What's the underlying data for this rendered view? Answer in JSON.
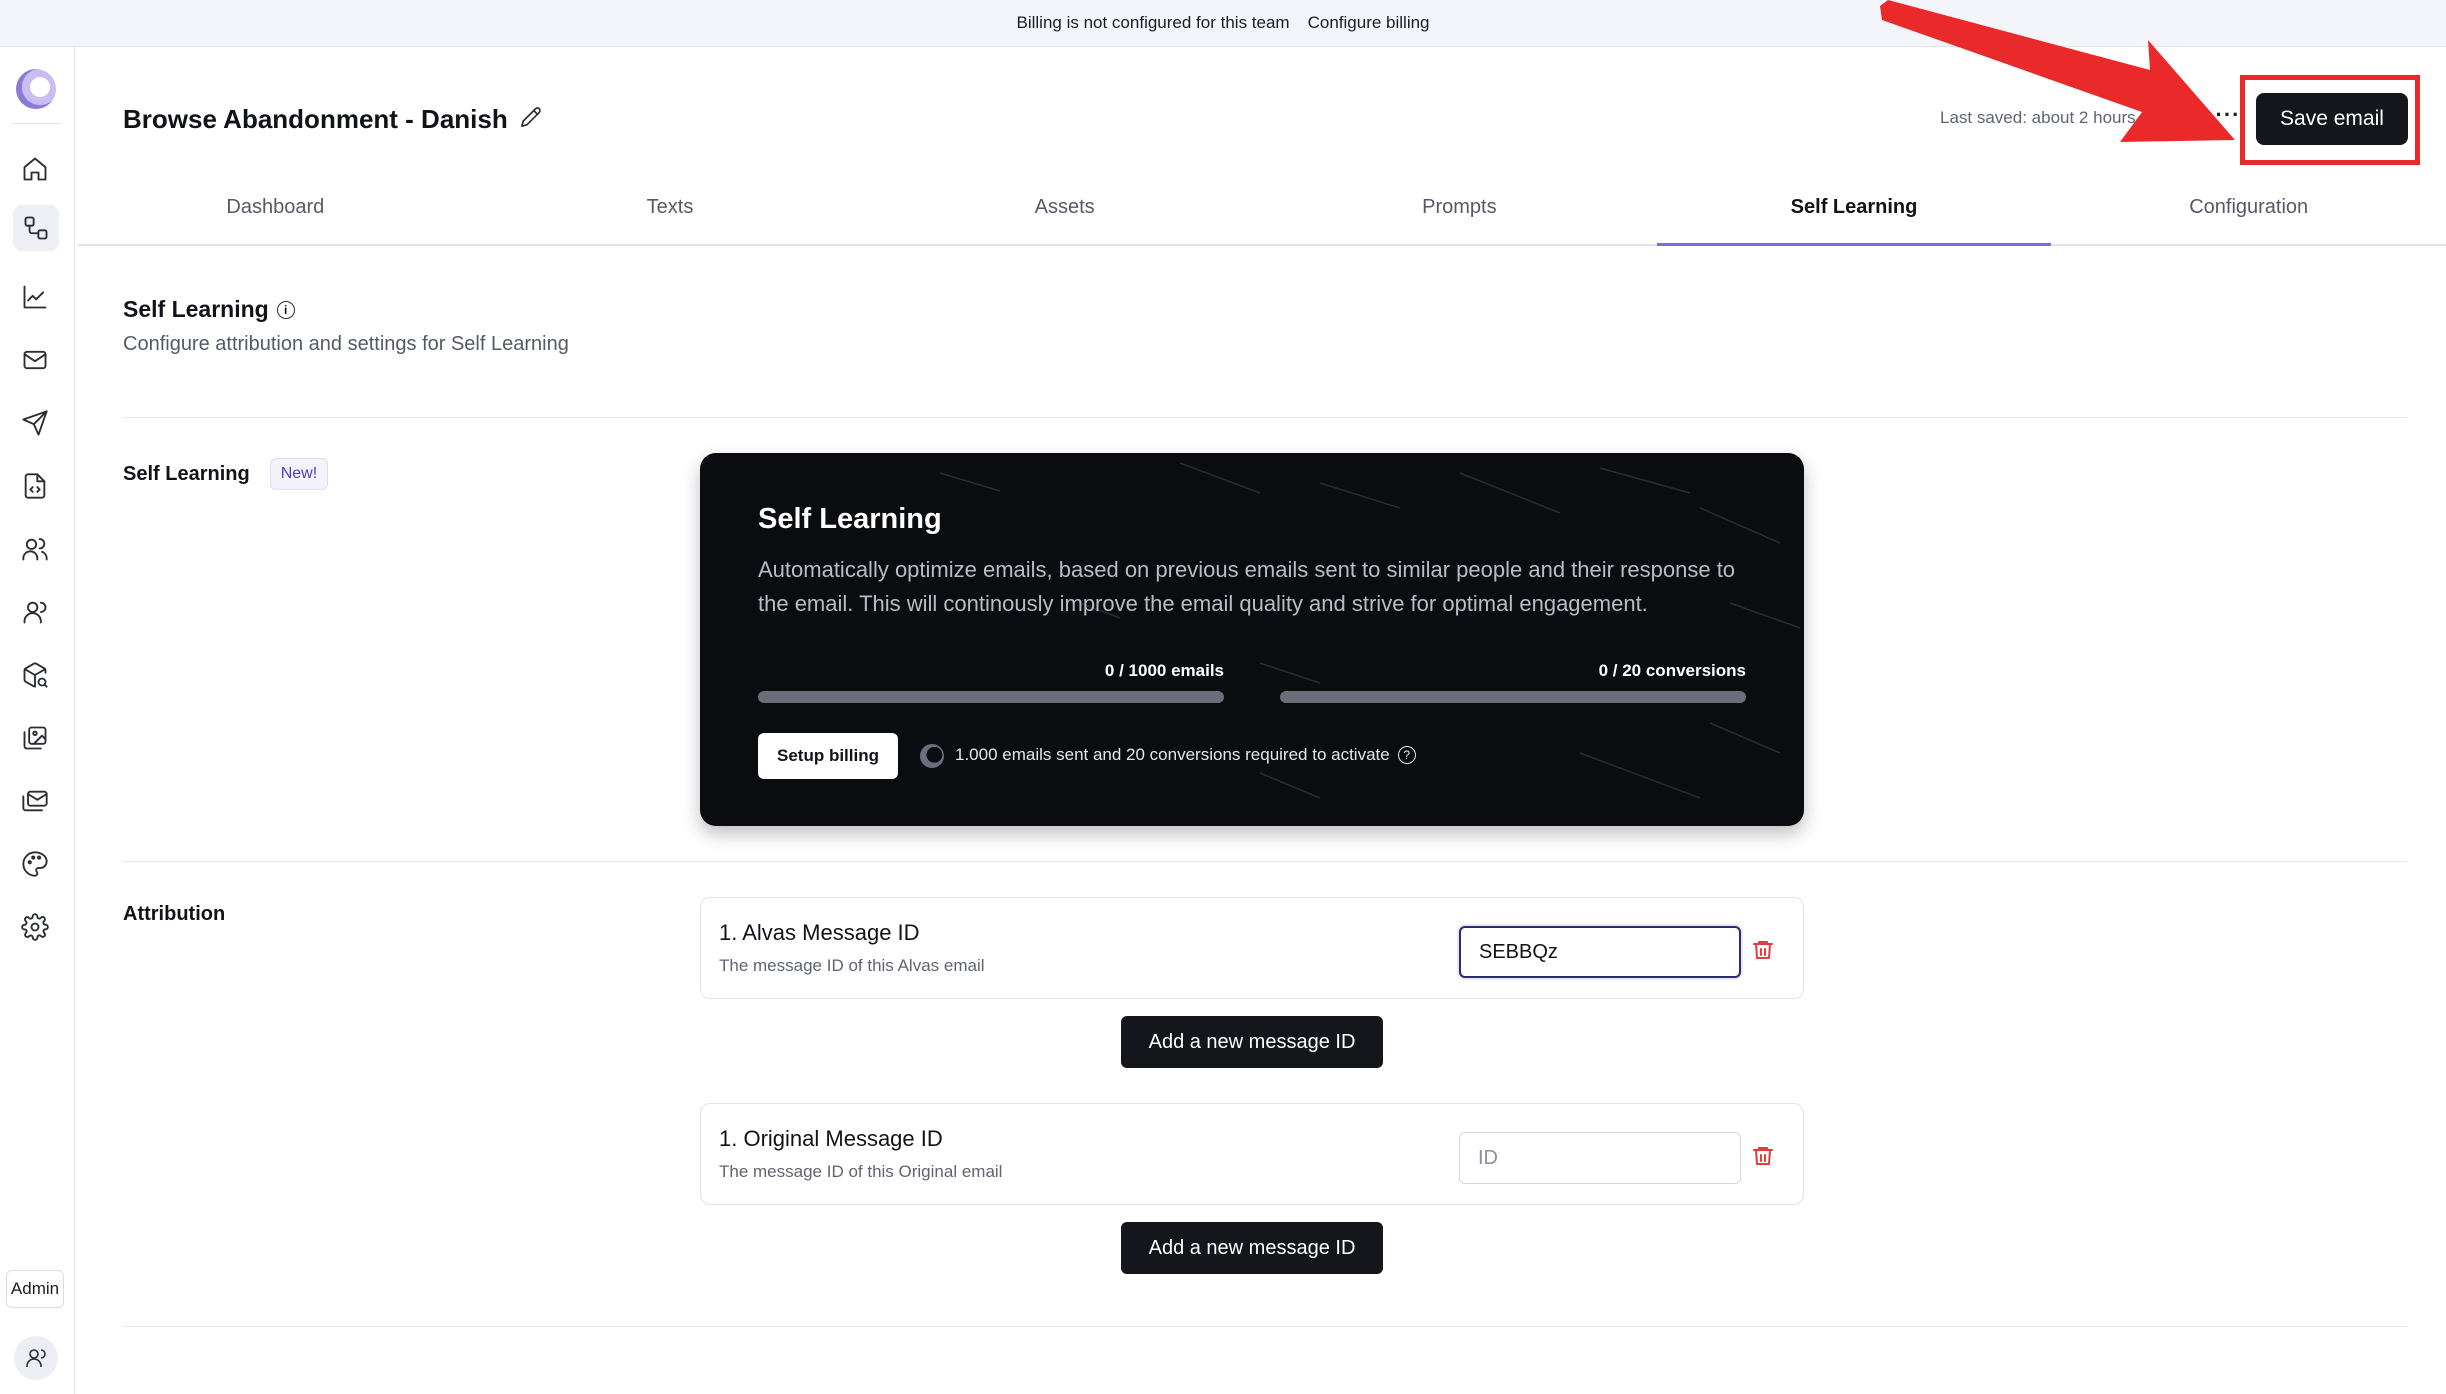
{
  "banner": {
    "message": "Billing is not configured for this team",
    "link": "Configure billing"
  },
  "sidebar": {
    "admin_label": "Admin",
    "icons": [
      "logo",
      "home-icon",
      "flows-icon",
      "chart-icon",
      "mail-icon",
      "send-icon",
      "code-file-icon",
      "users-icon",
      "user-icon",
      "package-search-icon",
      "image-icon",
      "mails-icon",
      "palette-icon",
      "gear-icon"
    ]
  },
  "header": {
    "title": "Browse Abandonment - Danish",
    "last_saved": "Last saved: about 2 hours ago",
    "more": "···",
    "save_label": "Save email"
  },
  "tabs": [
    {
      "label": "Dashboard",
      "active": false
    },
    {
      "label": "Texts",
      "active": false
    },
    {
      "label": "Assets",
      "active": false
    },
    {
      "label": "Prompts",
      "active": false
    },
    {
      "label": "Self Learning",
      "active": true
    },
    {
      "label": "Configuration",
      "active": false
    }
  ],
  "section": {
    "title": "Self Learning",
    "subtitle": "Configure attribution and settings for Self Learning"
  },
  "self_learning": {
    "label": "Self Learning",
    "badge": "New!",
    "card": {
      "title": "Self Learning",
      "description": "Automatically optimize emails, based on previous emails sent to similar people and their response to the email. This will continously improve the email quality and strive for optimal engagement.",
      "emails_progress": {
        "label": "0 / 1000 emails",
        "value": 0,
        "max": 1000
      },
      "conversions_progress": {
        "label": "0 / 20 conversions",
        "value": 0,
        "max": 20
      },
      "setup_label": "Setup billing",
      "requirement": "1.000 emails sent and 20 conversions required to activate"
    }
  },
  "attribution": {
    "label": "Attribution",
    "items": [
      {
        "title": "1. Alvas Message ID",
        "subtitle": "The message ID of this Alvas email",
        "value": "SEBBQz",
        "placeholder": "ID"
      },
      {
        "title": "1. Original Message ID",
        "subtitle": "The message ID of this Original email",
        "value": "",
        "placeholder": "ID"
      }
    ],
    "add_label": "Add a new message ID"
  },
  "colors": {
    "accent": "#7b6fe0",
    "primary_button": "#14161c",
    "danger": "#e23c3c",
    "annotation": "#ea2a2a"
  }
}
